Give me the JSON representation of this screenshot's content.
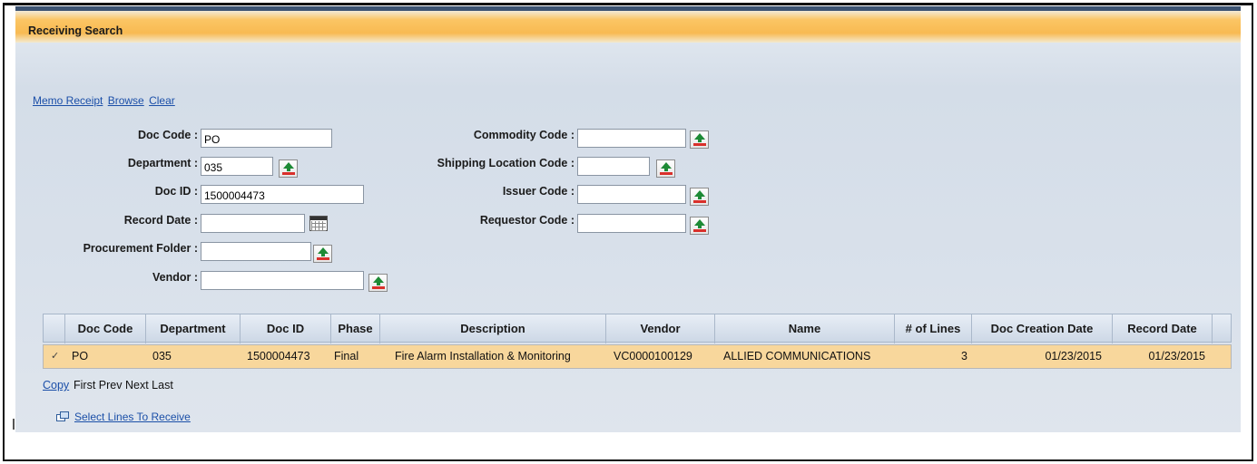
{
  "header": {
    "title": "Receiving Search"
  },
  "action_links": [
    "Memo Receipt",
    "Browse",
    "Clear"
  ],
  "form": {
    "doc_code": {
      "label": "Doc Code :",
      "value": "PO"
    },
    "department": {
      "label": "Department :",
      "value": "035"
    },
    "doc_id": {
      "label": "Doc ID :",
      "value": "1500004473"
    },
    "record_date": {
      "label": "Record Date :",
      "value": ""
    },
    "procurement_folder": {
      "label": "Procurement Folder :",
      "value": ""
    },
    "vendor": {
      "label": "Vendor :",
      "value": ""
    },
    "commodity_code": {
      "label": "Commodity Code :",
      "value": ""
    },
    "shipping_location_code": {
      "label": "Shipping Location Code :",
      "value": ""
    },
    "issuer_code": {
      "label": "Issuer Code :",
      "value": ""
    },
    "requestor_code": {
      "label": "Requestor Code :",
      "value": ""
    }
  },
  "table": {
    "columns": [
      "Doc Code",
      "Department",
      "Doc ID",
      "Phase",
      "Description",
      "Vendor",
      "Name",
      "# of Lines",
      "Doc Creation Date",
      "Record Date"
    ],
    "rows": [
      {
        "selected_mark": "✓",
        "doc_code": "PO",
        "department": "035",
        "doc_id": "1500004473",
        "phase": "Final",
        "description": "Fire Alarm Installation & Monitoring",
        "vendor": "VC0000100129",
        "name": "ALLIED COMMUNICATIONS",
        "lines": "3",
        "doc_creation_date": "01/23/2015",
        "record_date": "01/23/2015"
      }
    ]
  },
  "pager": {
    "copy": "Copy",
    "first": "First",
    "prev": "Prev",
    "next": "Next",
    "last": "Last"
  },
  "select_lines": {
    "label": "Select Lines To Receive",
    "icon": "windows-icon"
  },
  "colors": {
    "header_orange": "#f8ba52",
    "selected_row": "#f8d79c",
    "link": "#1b4fa8",
    "lookup_arrow": "#1d8a35"
  }
}
